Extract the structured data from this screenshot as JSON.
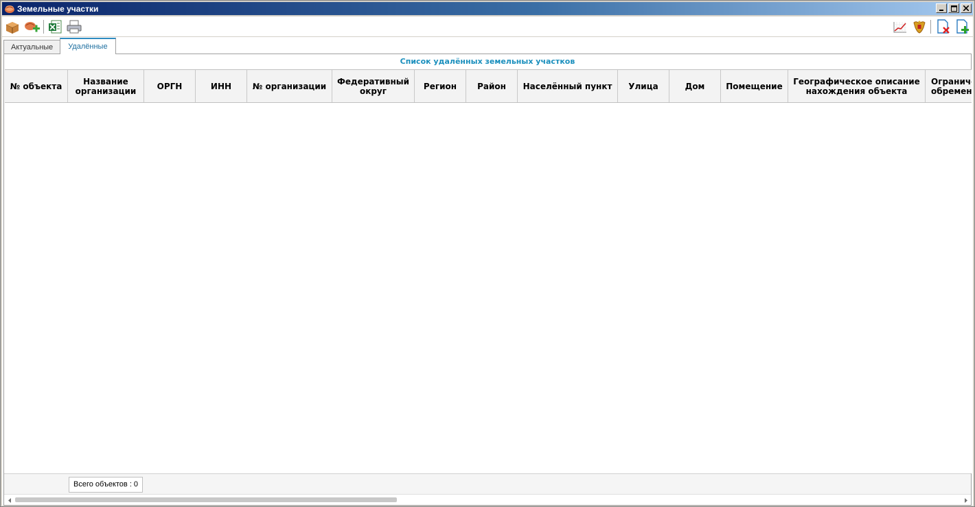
{
  "window": {
    "title": "Земельные участки"
  },
  "toolbar": {
    "left_icons": [
      "open-box-icon",
      "add-land-icon",
      "export-excel-icon",
      "print-icon"
    ],
    "right_icons": [
      "chart-icon",
      "emblem-icon",
      "delete-doc-icon",
      "add-doc-icon"
    ]
  },
  "tabs": [
    {
      "label": "Актуальные",
      "active": false
    },
    {
      "label": "Удалённые",
      "active": true
    }
  ],
  "list": {
    "title": "Список удалённых земельных участков",
    "columns": [
      "№ объекта",
      "Название\nорганизации",
      "ОРГН",
      "ИНН",
      "№ организации",
      "Федеративный\nокруг",
      "Регион",
      "Район",
      "Населённый пункт",
      "Улица",
      "Дом",
      "Помещение",
      "Географическое описание\nнахождения объекта",
      "Ограничения\nобременения"
    ],
    "rows": []
  },
  "status": {
    "count_label": "Всего объектов : 0"
  },
  "colors": {
    "accent": "#1a8fbd",
    "title_gradient_start": "#0a246a",
    "title_gradient_end": "#a6caf0"
  }
}
